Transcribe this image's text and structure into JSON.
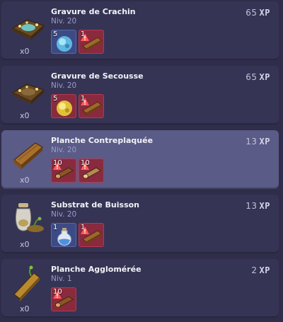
{
  "recipes": [
    {
      "name": "Gravure de Crachin",
      "level": "Niv. 20",
      "xp_value": "65",
      "xp_unit": "XP",
      "quantity": "x0",
      "icon": "engraving-blue-icon",
      "selected": false,
      "ingredients": [
        {
          "count": "5",
          "icon": "blue-orb-icon",
          "available": true
        },
        {
          "count": "1",
          "icon": "wood-plank-icon",
          "available": false
        }
      ]
    },
    {
      "name": "Gravure de Secousse",
      "level": "Niv. 20",
      "xp_value": "65",
      "xp_unit": "XP",
      "quantity": "x0",
      "icon": "engraving-gold-icon",
      "selected": false,
      "ingredients": [
        {
          "count": "5",
          "icon": "gold-orb-icon",
          "available": true
        },
        {
          "count": "1",
          "icon": "wood-plank-icon",
          "available": false
        }
      ]
    },
    {
      "name": "Planche Contreplaquée",
      "level": "Niv. 20",
      "xp_value": "13",
      "xp_unit": "XP",
      "quantity": "x0",
      "icon": "plywood-plank-icon",
      "selected": true,
      "ingredients": [
        {
          "count": "10",
          "icon": "log-icon",
          "available": false
        },
        {
          "count": "10",
          "icon": "log-light-icon",
          "available": false
        }
      ]
    },
    {
      "name": "Substrat de Buisson",
      "level": "Niv. 20",
      "xp_value": "13",
      "xp_unit": "XP",
      "quantity": "x0",
      "icon": "bush-substrate-icon",
      "selected": false,
      "ingredients": [
        {
          "count": "1",
          "icon": "water-flask-icon",
          "available": true
        },
        {
          "count": "1",
          "icon": "wood-plank-icon",
          "available": false
        }
      ]
    },
    {
      "name": "Planche Agglomérée",
      "level": "Niv. 1",
      "xp_value": "2",
      "xp_unit": "XP",
      "quantity": "x0",
      "icon": "chipboard-plank-icon",
      "selected": false,
      "ingredients": [
        {
          "count": "10",
          "icon": "log-icon",
          "available": false
        }
      ]
    }
  ]
}
